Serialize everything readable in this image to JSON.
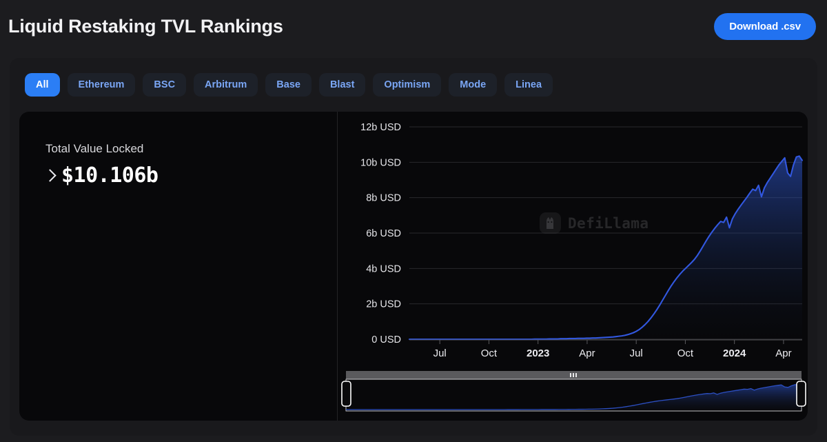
{
  "header": {
    "title": "Liquid Restaking TVL Rankings",
    "download_label": "Download .csv"
  },
  "filters": {
    "chains": [
      {
        "label": "All",
        "active": true
      },
      {
        "label": "Ethereum",
        "active": false
      },
      {
        "label": "BSC",
        "active": false
      },
      {
        "label": "Arbitrum",
        "active": false
      },
      {
        "label": "Base",
        "active": false
      },
      {
        "label": "Blast",
        "active": false
      },
      {
        "label": "Optimism",
        "active": false
      },
      {
        "label": "Mode",
        "active": false
      },
      {
        "label": "Linea",
        "active": false
      }
    ]
  },
  "stats": {
    "label": "Total Value Locked",
    "value": "$10.106b",
    "expand_icon": "chevron-right-icon"
  },
  "watermark": {
    "text": "DefiLlama",
    "logo": "defillama-llama-icon"
  },
  "colors": {
    "accent": "#2272f0",
    "chip_active_bg": "#2b7ef5",
    "chip_text": "#7aa6f5",
    "line": "#3258e0",
    "page_bg": "#1c1c1f",
    "card_bg": "#19191c",
    "chart_bg": "#08080a",
    "grid": "#2a2a2d"
  },
  "chart_data": {
    "type": "area",
    "title": "Total Value Locked",
    "xlabel": "",
    "ylabel": "USD",
    "ylim": [
      0,
      12
    ],
    "y_unit": "b USD",
    "grid": true,
    "legend": false,
    "y_ticks": [
      "0 USD",
      "2b USD",
      "4b USD",
      "6b USD",
      "8b USD",
      "10b USD",
      "12b USD"
    ],
    "y_tick_values": [
      0,
      2,
      4,
      6,
      8,
      10,
      12
    ],
    "x_ticks": [
      "Jul",
      "Oct",
      "2023",
      "Apr",
      "Jul",
      "Oct",
      "2024",
      "Apr"
    ],
    "x_tick_bold": [
      false,
      false,
      true,
      false,
      false,
      false,
      true,
      false
    ],
    "series": [
      {
        "name": "Liquid Restaking TVL",
        "unit": "billion USD",
        "latest_value": 10.106,
        "points": [
          0.0,
          0.0,
          0.0,
          0.0,
          0.0,
          0.0,
          0.0,
          0.0,
          0.0,
          0.0,
          0.0,
          0.0,
          0.0,
          0.0,
          0.0,
          0.0,
          0.0,
          0.0,
          0.0,
          0.0,
          0.0,
          0.0,
          0.0,
          0.0,
          0.0,
          0.0,
          0.0,
          0.0,
          0.0,
          0.0,
          0.0,
          0.0,
          0.0,
          0.0,
          0.0,
          0.0,
          0.0,
          0.0,
          0.0,
          0.0,
          0.0,
          0.0,
          0.0,
          0.01,
          0.01,
          0.01,
          0.01,
          0.01,
          0.02,
          0.02,
          0.02,
          0.02,
          0.03,
          0.03,
          0.03,
          0.04,
          0.04,
          0.04,
          0.05,
          0.05,
          0.05,
          0.06,
          0.06,
          0.07,
          0.07,
          0.08,
          0.09,
          0.1,
          0.11,
          0.12,
          0.13,
          0.15,
          0.17,
          0.19,
          0.22,
          0.26,
          0.31,
          0.37,
          0.45,
          0.55,
          0.68,
          0.83,
          1.0,
          1.2,
          1.42,
          1.66,
          1.92,
          2.2,
          2.48,
          2.76,
          3.02,
          3.26,
          3.48,
          3.68,
          3.86,
          4.02,
          4.18,
          4.34,
          4.52,
          4.74,
          5.0,
          5.28,
          5.56,
          5.82,
          6.06,
          6.28,
          6.48,
          6.66,
          6.6,
          6.9,
          6.3,
          6.8,
          7.1,
          7.35,
          7.58,
          7.8,
          8.02,
          8.26,
          8.48,
          8.4,
          8.7,
          8.05,
          8.55,
          8.85,
          9.1,
          9.35,
          9.6,
          9.85,
          10.05,
          10.25,
          9.4,
          9.2,
          9.85,
          10.3,
          10.35,
          10.106
        ]
      }
    ]
  },
  "zoom_slider": {
    "name": "data-zoom-brush",
    "left_handle": "range-start-handle",
    "right_handle": "range-end-handle",
    "grip": "drag-grip-icon",
    "start_pct": 0,
    "end_pct": 100
  }
}
